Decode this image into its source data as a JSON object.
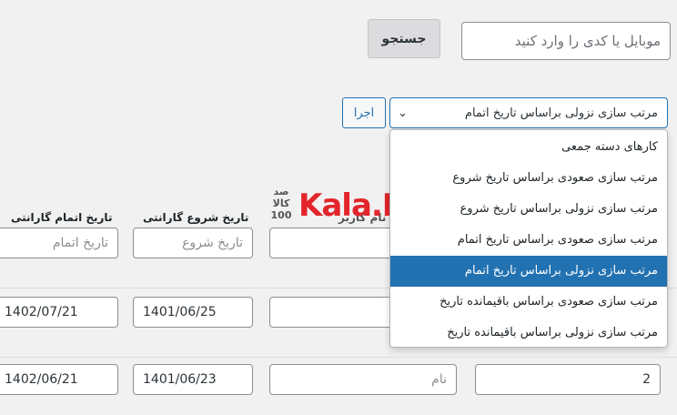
{
  "search": {
    "placeholder": "موبایل یا کدی را وارد کنید",
    "button_label": "جستجو"
  },
  "sort": {
    "selected_label": "مرتب سازی نزولی براساس تاریخ اتمام",
    "apply_label": "اجرا",
    "options": [
      "کارهای دسته جمعی",
      "مرتب سازی صعودی براساس تاریخ شروع",
      "مرتب سازی نزولی براساس تاریخ شروع",
      "مرتب سازی صعودی براساس تاریخ اتمام",
      "مرتب سازی نزولی براساس تاریخ اتمام",
      "مرتب سازی صعودی براساس باقیمانده تاریخ",
      "مرتب سازی نزولی براساس باقیمانده تاریخ"
    ],
    "selected_index": 4
  },
  "columns": {
    "warranty_end": "تاریخ اتمام گارانتی",
    "warranty_start": "تاریخ شروع گارانتی",
    "user_name": "نام کاربر"
  },
  "filters": {
    "end_placeholder": "تاریخ اتمام",
    "start_placeholder": "تاریخ شروع"
  },
  "rows": [
    {
      "end_date": "1402/07/21",
      "start_date": "1401/06/25"
    },
    {
      "end_date": "1402/06/21",
      "start_date": "1401/06/23",
      "name_placeholder": "نام",
      "number": "2"
    }
  ],
  "logo": {
    "mark_text": "صد\nکالا\n100",
    "brand_text": "Kala.Ir"
  },
  "colors": {
    "accent": "#2271b1",
    "brand_red": "#e3242b",
    "background": "#f1f1f1"
  }
}
